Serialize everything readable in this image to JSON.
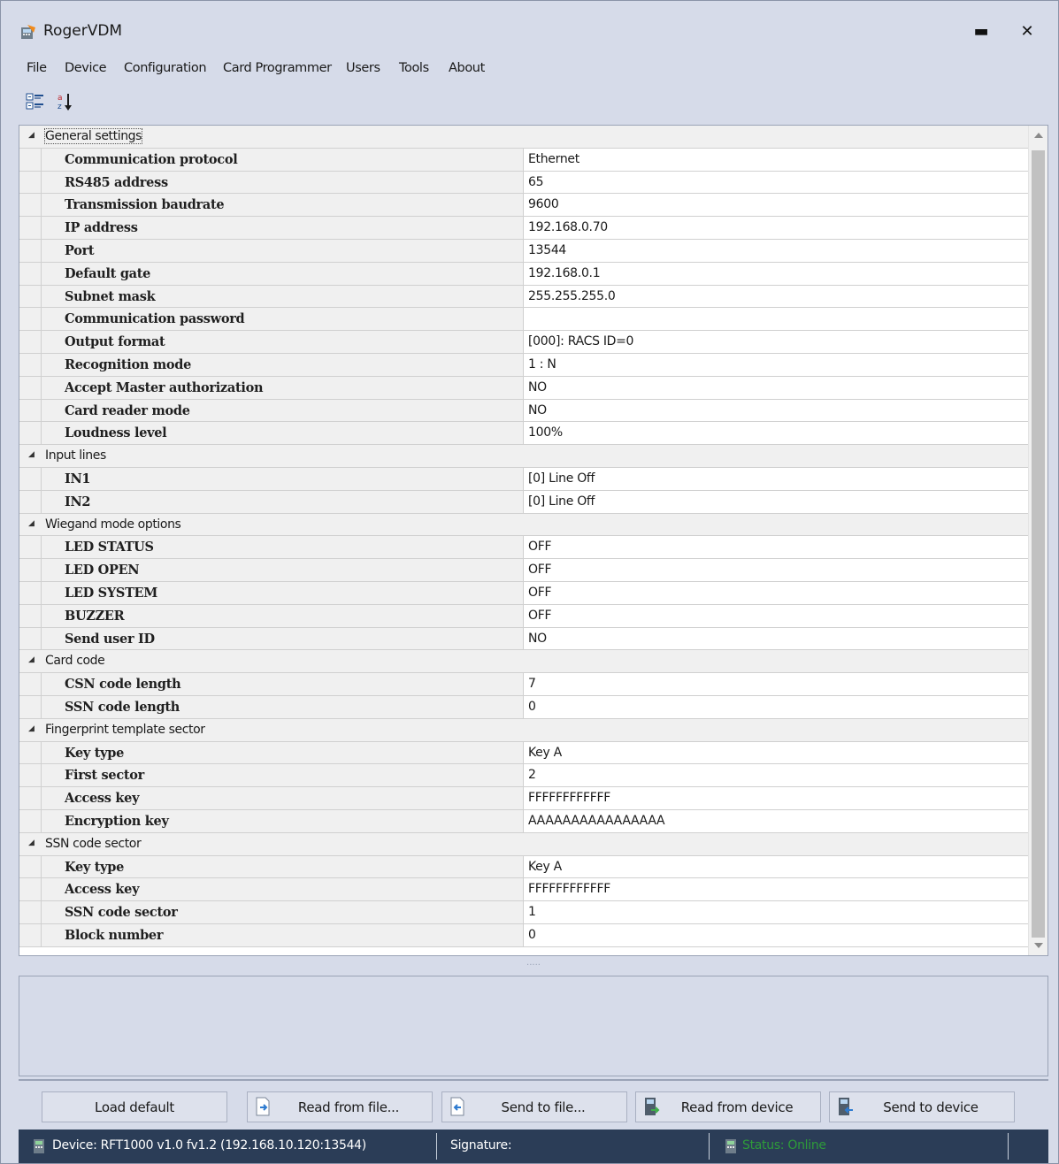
{
  "window": {
    "title": "RogerVDM",
    "minimize_glyph": "▬",
    "close_glyph": "✕"
  },
  "menu": [
    "File",
    "Device",
    "Configuration",
    "Card Programmer",
    "Users",
    "Tools",
    "About"
  ],
  "toolbar": {
    "categorized_icon": "categorized-view-icon",
    "alphabetical_icon": "sort-alphabetical-icon"
  },
  "grid": {
    "categories": [
      {
        "label": "General settings",
        "expanded": true,
        "properties": [
          {
            "name": "Communication protocol",
            "value": "Ethernet"
          },
          {
            "name": "RS485 address",
            "value": "65"
          },
          {
            "name": "Transmission baudrate",
            "value": "9600"
          },
          {
            "name": "IP address",
            "value": "192.168.0.70"
          },
          {
            "name": "Port",
            "value": "13544"
          },
          {
            "name": "Default gate",
            "value": "192.168.0.1"
          },
          {
            "name": "Subnet mask",
            "value": "255.255.255.0"
          },
          {
            "name": "Communication password",
            "value": ""
          },
          {
            "name": "Output format",
            "value": "[000]: RACS ID=0"
          },
          {
            "name": "Recognition mode",
            "value": "1 : N"
          },
          {
            "name": "Accept Master authorization",
            "value": "NO"
          },
          {
            "name": "Card reader mode",
            "value": "NO"
          },
          {
            "name": "Loudness level",
            "value": "100%"
          }
        ]
      },
      {
        "label": "Input lines",
        "expanded": true,
        "properties": [
          {
            "name": "IN1",
            "value": "[0] Line Off"
          },
          {
            "name": "IN2",
            "value": "[0] Line Off"
          }
        ]
      },
      {
        "label": "Wiegand mode options",
        "expanded": true,
        "properties": [
          {
            "name": "LED STATUS",
            "value": "OFF"
          },
          {
            "name": "LED OPEN",
            "value": "OFF"
          },
          {
            "name": "LED SYSTEM",
            "value": "OFF"
          },
          {
            "name": "BUZZER",
            "value": "OFF"
          },
          {
            "name": "Send user ID",
            "value": "NO"
          }
        ]
      },
      {
        "label": "Card code",
        "expanded": true,
        "properties": [
          {
            "name": "CSN code length",
            "value": "7"
          },
          {
            "name": "SSN code length",
            "value": "0"
          }
        ]
      },
      {
        "label": "Fingerprint template sector",
        "expanded": true,
        "properties": [
          {
            "name": "Key type",
            "value": "Key A"
          },
          {
            "name": "First sector",
            "value": "2"
          },
          {
            "name": "Access key",
            "value": "FFFFFFFFFFFF"
          },
          {
            "name": "Encryption key",
            "value": "AAAAAAAAAAAAAAAA"
          }
        ]
      },
      {
        "label": "SSN code sector",
        "expanded": true,
        "properties": [
          {
            "name": "Key type",
            "value": "Key A"
          },
          {
            "name": "Access key",
            "value": "FFFFFFFFFFFF"
          },
          {
            "name": "SSN code sector",
            "value": "1"
          },
          {
            "name": "Block number",
            "value": "0"
          }
        ]
      }
    ]
  },
  "splitter_grip": "·····",
  "buttons": {
    "load_default": "Load default",
    "read_from_file": "Read from file...",
    "send_to_file": "Send to file...",
    "read_from_device": "Read from device",
    "send_to_device": "Send to device"
  },
  "status": {
    "device": "Device: RFT1000 v1.0 fv1.2 (192.168.10.120:13544)",
    "signature": "Signature:",
    "status": "Status: Online",
    "status_color": "#2e9b3a"
  }
}
